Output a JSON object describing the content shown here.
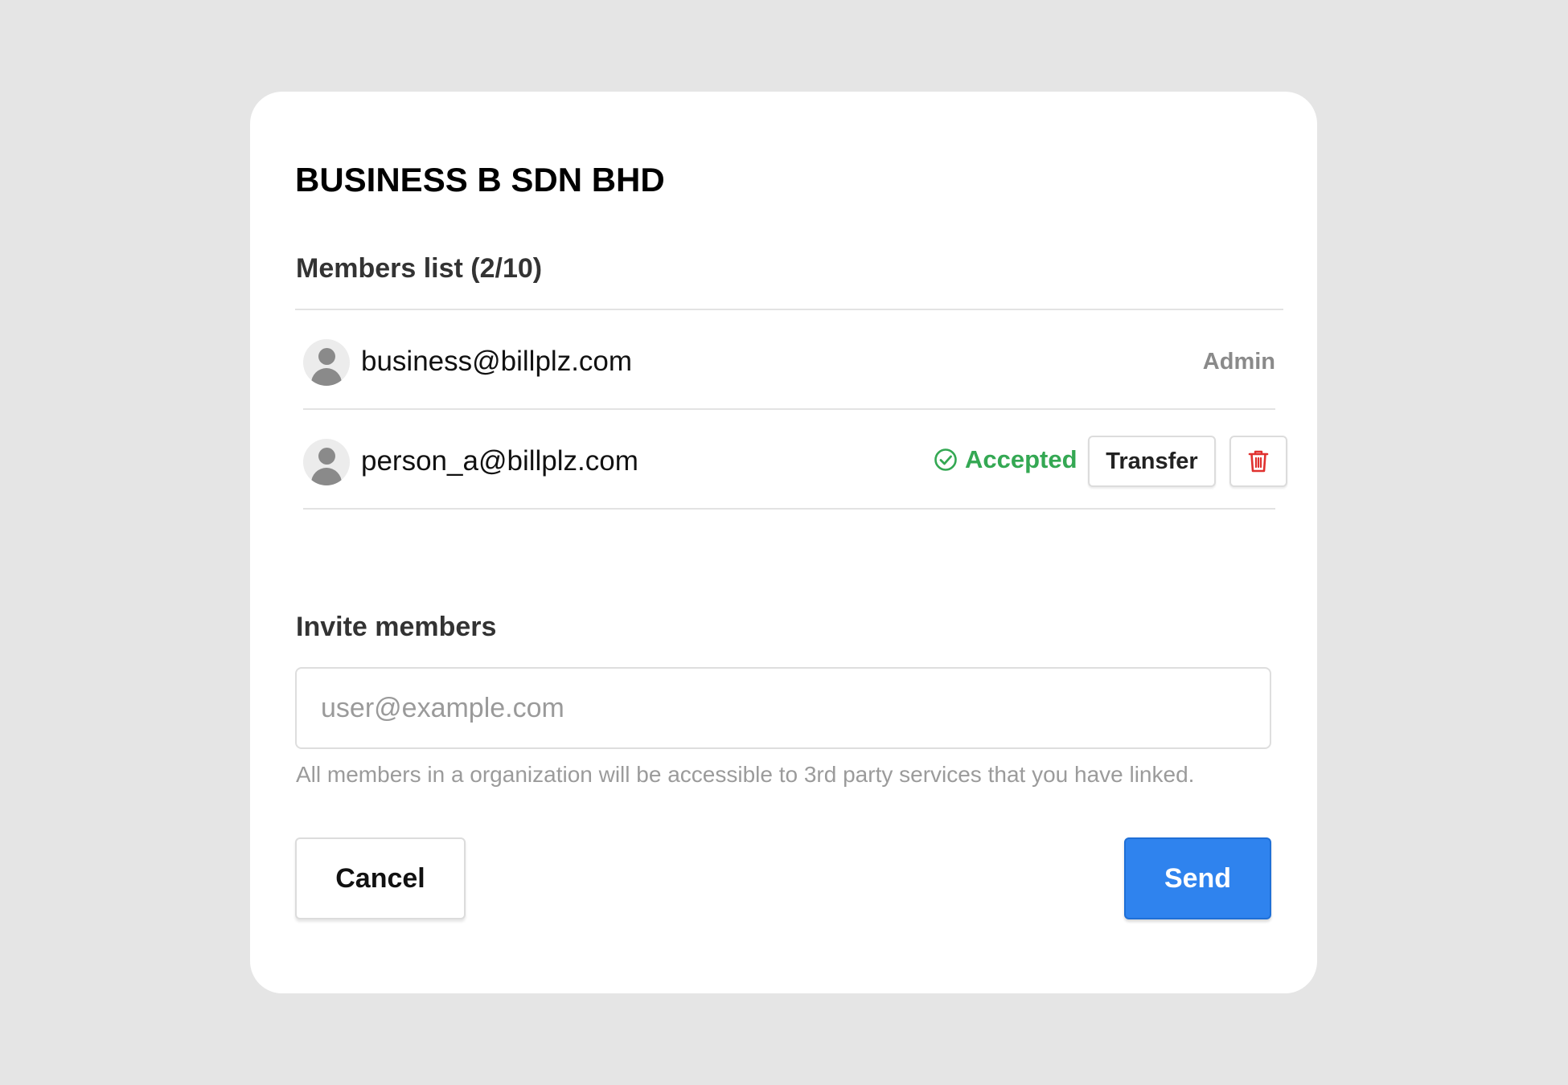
{
  "organization": {
    "name": "BUSINESS B SDN BHD"
  },
  "members": {
    "title": "Members list (2/10)",
    "rows": [
      {
        "email": "business@billplz.com",
        "role": "Admin"
      },
      {
        "email": "person_a@billplz.com",
        "status": "Accepted",
        "transfer_label": "Transfer",
        "delete_icon": "trash-icon"
      }
    ]
  },
  "invite": {
    "title": "Invite members",
    "placeholder": "user@example.com",
    "value": "",
    "helper": "All members in a organization will be accessible to 3rd party services that you have linked."
  },
  "actions": {
    "cancel_label": "Cancel",
    "send_label": "Send"
  },
  "colors": {
    "accent": "#2f83ee",
    "success": "#34a853",
    "danger": "#e0312f",
    "backdrop": "#e5e5e5"
  }
}
